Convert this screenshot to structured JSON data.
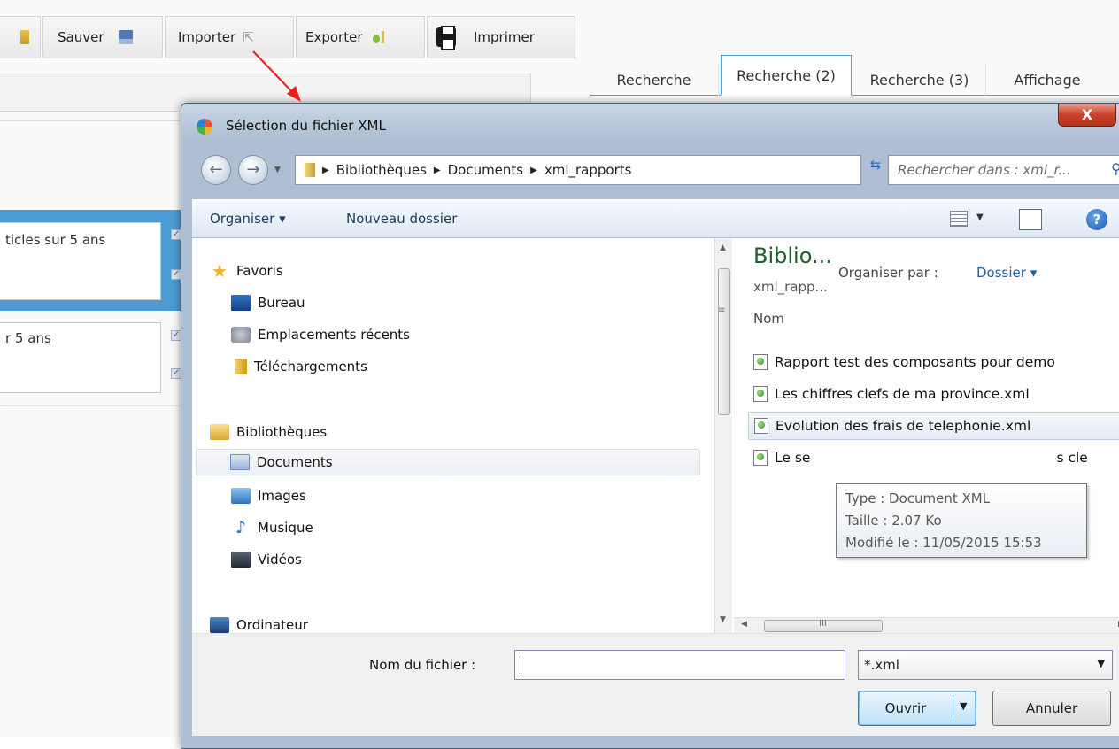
{
  "toolbar": {
    "buttons": [
      {
        "label": "",
        "icon": "folder-icon"
      },
      {
        "label": "Sauver",
        "icon": "floppy-icon"
      },
      {
        "label": "Importer",
        "icon": "import-icon"
      },
      {
        "label": "Exporter",
        "icon": "export-icon"
      },
      {
        "label": "Imprimer",
        "icon": "printer-icon"
      }
    ]
  },
  "tabs": [
    {
      "label": "Recherche",
      "active": false
    },
    {
      "label": "Recherche (2)",
      "active": true
    },
    {
      "label": "Recherche (3)",
      "active": false
    },
    {
      "label": "Affichage",
      "active": false
    }
  ],
  "background_fields": {
    "field1_text": "ticles sur 5 ans",
    "field2_text": "r 5 ans"
  },
  "dialog": {
    "title": "Sélection du fichier XML",
    "close_label": "X",
    "address": {
      "segments": [
        "Bibliothèques",
        "Documents",
        "xml_rapports"
      ],
      "search_placeholder": "Rechercher dans : xml_r..."
    },
    "command_bar": {
      "organize": "Organiser ▾",
      "new_folder": "Nouveau dossier",
      "help": "?"
    },
    "navigation": {
      "favorites_header": "Favoris",
      "favorites": [
        {
          "label": "Bureau",
          "icon": "desktop-icon"
        },
        {
          "label": "Emplacements récents",
          "icon": "recent-places-icon"
        },
        {
          "label": "Téléchargements",
          "icon": "downloads-icon"
        }
      ],
      "libraries_header": "Bibliothèques",
      "libraries": [
        {
          "label": "Documents",
          "icon": "documents-icon",
          "selected": true
        },
        {
          "label": "Images",
          "icon": "images-icon"
        },
        {
          "label": "Musique",
          "icon": "music-icon"
        },
        {
          "label": "Vidéos",
          "icon": "videos-icon"
        }
      ],
      "computer": "Ordinateur"
    },
    "file_pane": {
      "library_title": "Biblio...",
      "library_subtitle": "xml_rapp...",
      "arrange_label": "Organiser par :",
      "arrange_value": "Dossier ▾",
      "column_name": "Nom",
      "files": [
        {
          "name": "Rapport test des composants pour demo"
        },
        {
          "name": "Les chiffres clefs de ma province.xml"
        },
        {
          "name": "Evolution des frais de telephonie.xml",
          "hover": true
        },
        {
          "name": "Le se",
          "tail": "s cle"
        }
      ]
    },
    "tooltip": {
      "type": "Type : Document XML",
      "size": "Taille : 2.07 Ko",
      "modified": "Modifié le : 11/05/2015 15:53"
    },
    "footer": {
      "filename_label": "Nom du fichier :",
      "filename_value": "",
      "filter_value": "*.xml",
      "open_label": "Ouvrir",
      "cancel_label": "Annuler"
    }
  },
  "colors": {
    "arrow": "#e8201d",
    "tab_accent": "#4fa6dc",
    "library_title": "#1e5e27",
    "link_blue": "#1f5fa8"
  }
}
